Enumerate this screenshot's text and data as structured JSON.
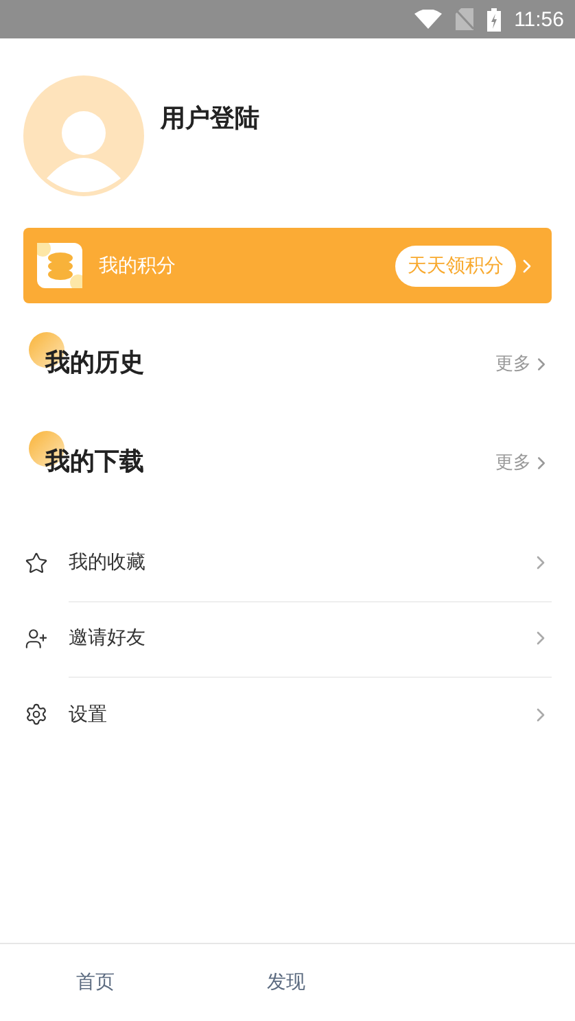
{
  "status_bar": {
    "time": "11:56"
  },
  "profile": {
    "name": "用户登陆"
  },
  "points": {
    "label": "我的积分",
    "action": "天天领积分"
  },
  "sections": [
    {
      "title": "我的历史",
      "more": "更多"
    },
    {
      "title": "我的下载",
      "more": "更多"
    }
  ],
  "menu": [
    {
      "kind": "star",
      "label": "我的收藏"
    },
    {
      "kind": "invite",
      "label": "邀请好友"
    },
    {
      "kind": "settings",
      "label": "设置"
    }
  ],
  "tab_bar": [
    {
      "label": "首页"
    },
    {
      "label": "发现"
    }
  ]
}
